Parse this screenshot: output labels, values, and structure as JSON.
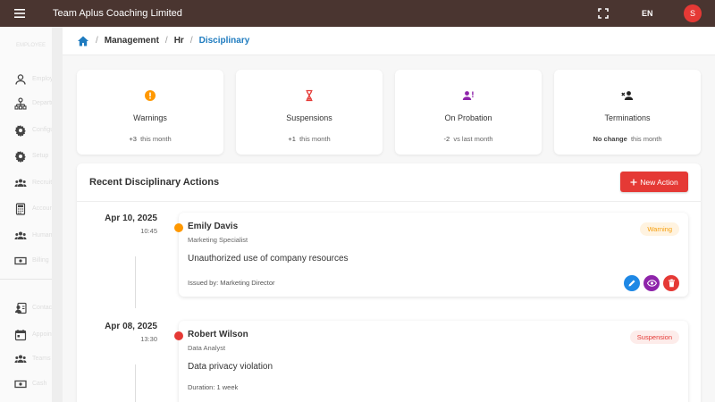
{
  "app": {
    "title": "Team Aplus Coaching Limited",
    "lang": "EN",
    "avatar_initial": "S"
  },
  "colors": {
    "topbar": "#4a3530",
    "accent": "#1e7bbf",
    "danger": "#e53935",
    "warning": "#ff9800"
  },
  "sidebar": {
    "heading": "EMPLOYEE",
    "items": [
      {
        "icon": "person-icon",
        "label": "Employees"
      },
      {
        "icon": "org-chart-icon",
        "label": "Departments"
      },
      {
        "icon": "gear-icon",
        "label": "Configurations\nSettings"
      },
      {
        "icon": "gear-icon",
        "label": "Setup"
      },
      {
        "icon": "groups-icon",
        "label": "Recruitment\nManagement"
      },
      {
        "icon": "calculator-icon",
        "label": "Accounts"
      },
      {
        "icon": "groups-icon",
        "label": "Human\nResources"
      },
      {
        "icon": "money-icon",
        "label": "Billing"
      },
      {
        "icon": "contact-icon",
        "label": "Contacts\nPlanner"
      },
      {
        "icon": "calendar-icon",
        "label": "Appointments"
      },
      {
        "icon": "groups-icon",
        "label": "Teams"
      },
      {
        "icon": "money-icon",
        "label": "Cash"
      }
    ]
  },
  "breadcrumb": {
    "items": [
      "Management",
      "Hr",
      "Disciplinary"
    ]
  },
  "stats": [
    {
      "icon": "warning-icon",
      "label": "Warnings",
      "change": "+3",
      "period": "this month",
      "color": "#ff9800"
    },
    {
      "icon": "hourglass-icon",
      "label": "Suspensions",
      "change": "+1",
      "period": "this month",
      "color": "#e53935"
    },
    {
      "icon": "probation-icon",
      "label": "On Probation",
      "change": "-2",
      "period": "vs last month",
      "color": "#8e24aa"
    },
    {
      "icon": "person-remove-icon",
      "label": "Terminations",
      "change": "No change",
      "period": "this month",
      "color": "#222222"
    }
  ],
  "panel": {
    "title": "Recent Disciplinary Actions",
    "new_action_label": "New Action"
  },
  "actions": [
    {
      "date": "Apr 10, 2025",
      "time": "10:45",
      "name": "Emily Davis",
      "role": "Marketing Specialist",
      "badge": "Warning",
      "badge_color": "#ff9800",
      "description": "Unauthorized use of company resources",
      "meta": "Issued by: Marketing Director"
    },
    {
      "date": "Apr 08, 2025",
      "time": "13:30",
      "name": "Robert Wilson",
      "role": "Data Analyst",
      "badge": "Suspension",
      "badge_color": "#e53935",
      "description": "Data privacy violation",
      "meta": "Duration: 1 week"
    }
  ]
}
